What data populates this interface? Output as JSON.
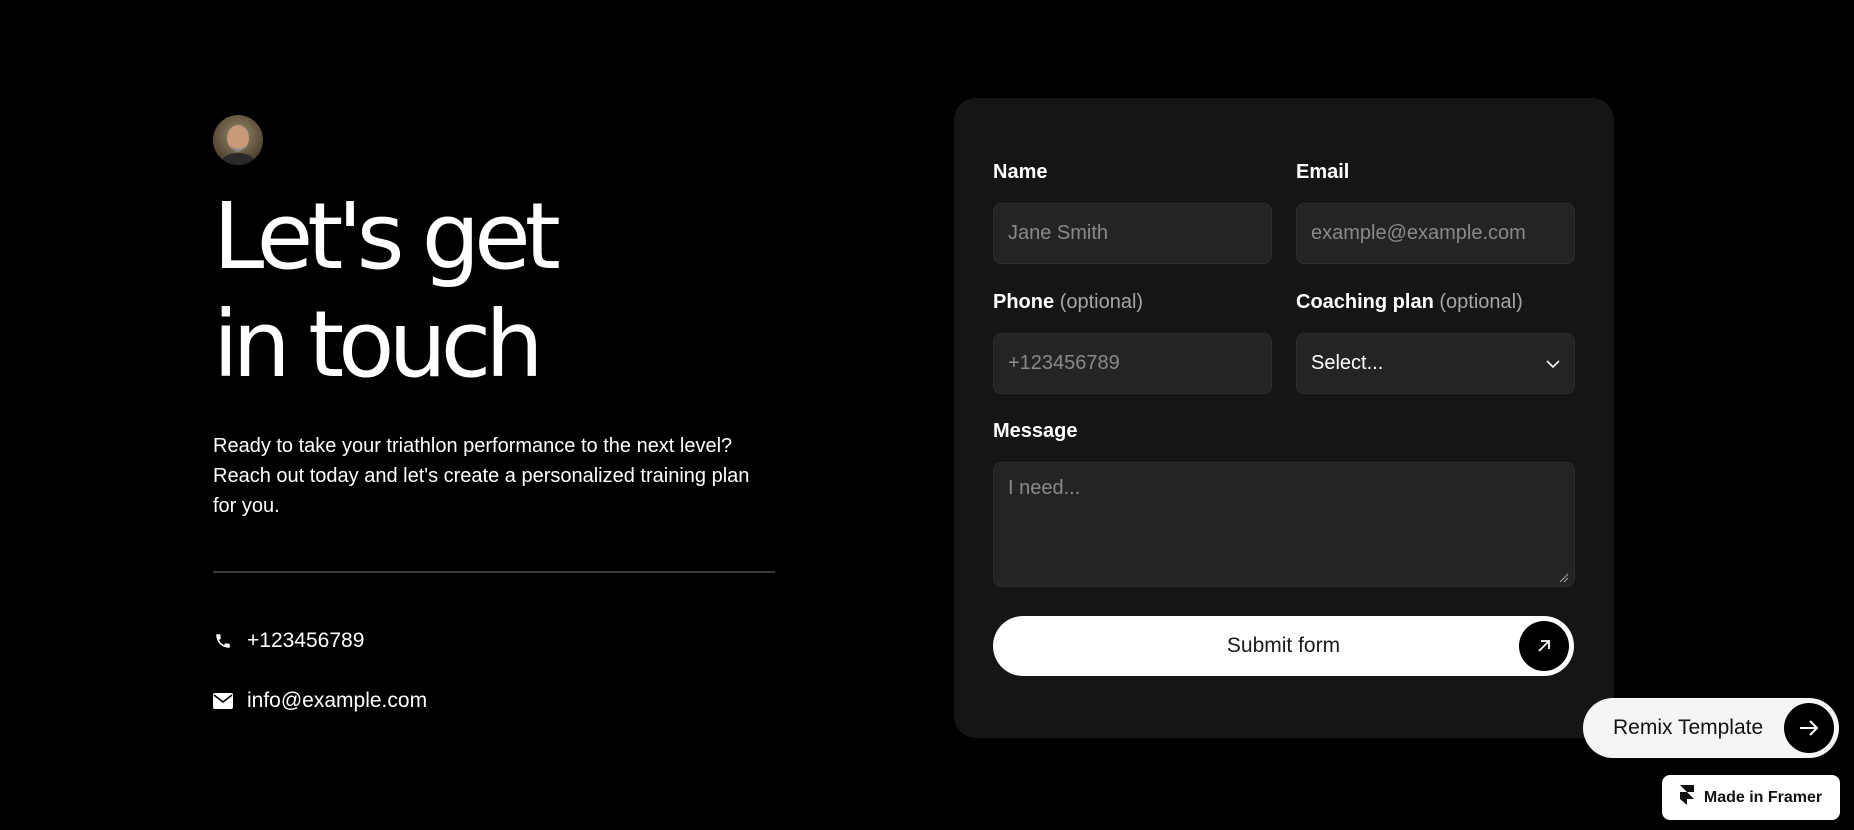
{
  "hero": {
    "headline_line1": "Let's get",
    "headline_line2": "in touch",
    "intro": "Ready to take your triathlon performance to the next level? Reach out today and let's create a personalized training plan for you."
  },
  "contact": {
    "phone": "+123456789",
    "email": "info@example.com",
    "phone_icon": "phone-icon",
    "email_icon": "envelope-icon"
  },
  "form": {
    "name_label": "Name",
    "name_placeholder": "Jane Smith",
    "email_label": "Email",
    "email_placeholder": "example@example.com",
    "phone_label": "Phone",
    "phone_optional": "(optional)",
    "phone_placeholder": "+123456789",
    "plan_label": "Coaching plan",
    "plan_optional": "(optional)",
    "plan_value": "Select...",
    "message_label": "Message",
    "message_placeholder": "I need...",
    "submit_label": "Submit form"
  },
  "badges": {
    "remix_label": "Remix Template",
    "framer_label": "Made in Framer"
  },
  "colors": {
    "background": "#000000",
    "card": "#151515",
    "field": "#242424",
    "accent": "#ffffff"
  }
}
